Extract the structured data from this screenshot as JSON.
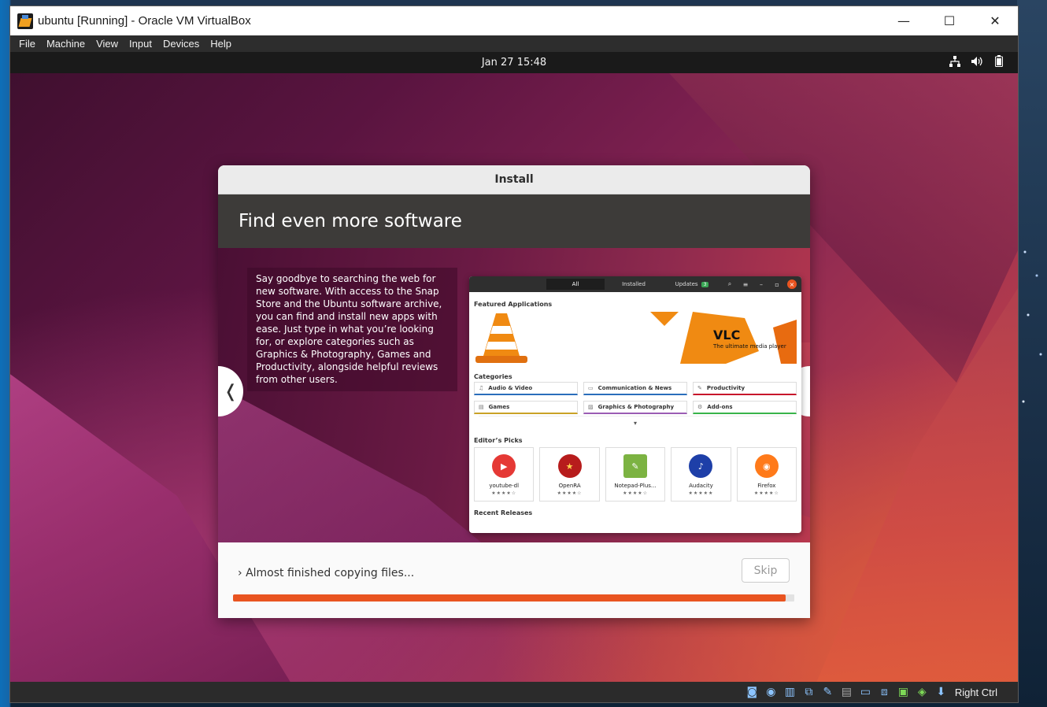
{
  "window": {
    "title": "ubuntu [Running] - Oracle VM VirtualBox",
    "controls": {
      "minimize": "—",
      "maximize": "☐",
      "close": "✕"
    }
  },
  "menubar": {
    "items": [
      "File",
      "Machine",
      "View",
      "Input",
      "Devices",
      "Help"
    ]
  },
  "guest": {
    "clock": "Jan 27  15:48",
    "tray": {
      "network_icon": "network-icon",
      "volume_icon": "volume-icon",
      "battery_icon": "battery-icon"
    }
  },
  "installer": {
    "title": "Install",
    "heading": "Find even more software",
    "slide_text": "Say goodbye to searching the web for new software. With access to the Snap Store and the Ubuntu software archive, you can find and install new apps with ease. Just type in what you’re looking for, or explore categories such as Graphics & Photography, Games and Productivity, alongside helpful reviews from other users.",
    "prev_label": "❬",
    "next_label": "❭",
    "status": "Almost finished copying files...",
    "status_chevron": "›",
    "skip_label": "Skip",
    "progress": 0.985,
    "accent": "#e95420"
  },
  "store": {
    "tabs": [
      "All",
      "Installed",
      "Updates"
    ],
    "updates_count": "3",
    "featured_label": "Featured Applications",
    "vlc_name": "VLC",
    "vlc_tagline": "The ultimate media player",
    "categories_label": "Categories",
    "categories": [
      {
        "label": "Audio & Video",
        "color": "#2a6ebb",
        "icon": "♫"
      },
      {
        "label": "Communication & News",
        "color": "#2a6ebb",
        "icon": "▭"
      },
      {
        "label": "Productivity",
        "color": "#c7162b",
        "icon": "✎"
      },
      {
        "label": "Games",
        "color": "#c9a227",
        "icon": "▤"
      },
      {
        "label": "Graphics & Photography",
        "color": "#9b5cb4",
        "icon": "▨"
      },
      {
        "label": "Add-ons",
        "color": "#38b44a",
        "icon": "⚙"
      }
    ],
    "more_label": "▾",
    "picks_label": "Editor’s Picks",
    "picks": [
      {
        "name": "youtube-dl",
        "stars": "★★★★☆",
        "icon_bg": "#e53935",
        "glyph": "▶"
      },
      {
        "name": "OpenRA",
        "stars": "★★★★☆",
        "icon_bg": "#b71c1c",
        "glyph": "★"
      },
      {
        "name": "Notepad-Plus...",
        "stars": "★★★★☆",
        "icon_bg": "#7cb342",
        "glyph": "✎"
      },
      {
        "name": "Audacity",
        "stars": "★★★★★",
        "icon_bg": "#1e3fa8",
        "glyph": "♪"
      },
      {
        "name": "Firefox",
        "stars": "★★★★☆",
        "icon_bg": "#ff7a1a",
        "glyph": "◉"
      }
    ],
    "recent_label": "Recent Releases"
  },
  "vbox_status": {
    "icons": [
      "optical-drive-icon",
      "audio-icon",
      "network-adapter-icon",
      "usb-icon",
      "shared-folder-icon",
      "display-icon",
      "recording-icon",
      "vm-display-icon",
      "cpu-icon",
      "mouse-integration-icon",
      "host-key-arrow-icon"
    ],
    "host_key": "Right Ctrl"
  }
}
